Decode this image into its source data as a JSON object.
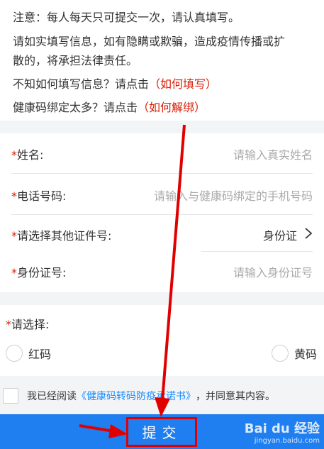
{
  "notice": {
    "line1": "注意：每人每天只可提交一次，请认真填写。",
    "line2a": "请如实填写信息，如有隐瞒或欺骗，造成疫情传播或扩",
    "line2b": "散的，将承担法律责任。",
    "line3_text": "不知如何填写信息？请点击",
    "line3_link": "（如何填写）",
    "line4_text": "健康码绑定太多？请点击",
    "line4_link": "（如何解绑）"
  },
  "form": {
    "required_mark": "*",
    "name_label": "姓名:",
    "name_placeholder": "请输入真实姓名",
    "phone_label": "电话号码:",
    "phone_placeholder": "请输入与健康码绑定的手机号码",
    "idtype_label": "请选择其他证件号:",
    "idtype_value": "身份证",
    "idnum_label": "身份证号:",
    "idnum_placeholder": "请输入身份证号"
  },
  "select": {
    "label": "请选择:",
    "option_red": "红码",
    "option_yellow": "黄码"
  },
  "agreement": {
    "prefix": "我已经阅读",
    "link": "《健康码转码防疫承诺书》",
    "suffix": "，并同意其内容。"
  },
  "submit": {
    "label": "提交"
  },
  "watermark": {
    "brand": "Bai du 经验",
    "sub": "jingyan.baidu.com"
  },
  "colors": {
    "accent_red": "#d81e06",
    "link_blue": "#1a8cff",
    "submit_blue": "#1f7ef0",
    "annotation_red": "#e00000"
  }
}
